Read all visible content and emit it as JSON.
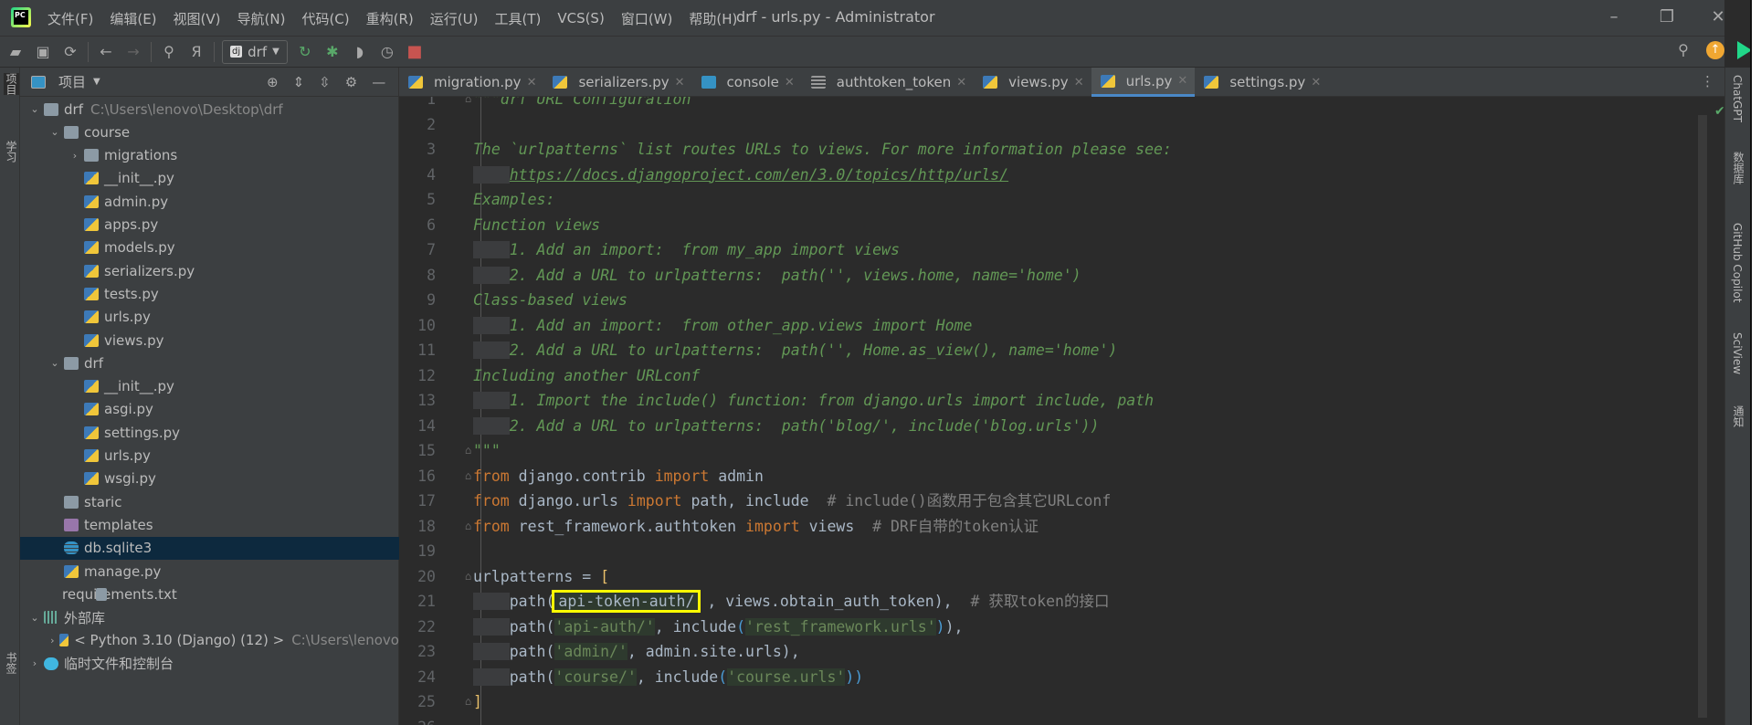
{
  "window": {
    "title": "drf - urls.py - Administrator",
    "minimize": "–",
    "restore": "❐",
    "close": "✕"
  },
  "menu": [
    "文件(F)",
    "编辑(E)",
    "视图(V)",
    "导航(N)",
    "代码(C)",
    "重构(R)",
    "运行(U)",
    "工具(T)",
    "VCS(S)",
    "窗口(W)",
    "帮助(H)"
  ],
  "toolbar": {
    "run_config": "drf",
    "icons": [
      "open-icon",
      "save-icon",
      "sync-icon",
      "back-icon",
      "forward-icon",
      "search-icon",
      "replace-icon"
    ]
  },
  "left_stripe": {
    "project": "项目",
    "learn": "学习",
    "bookmarks": "书签"
  },
  "project": {
    "title": "项目",
    "tree": [
      {
        "level": 0,
        "chev": "⌄",
        "icon": "folder",
        "label": "drf",
        "path": "C:\\Users\\lenovo\\Desktop\\drf"
      },
      {
        "level": 1,
        "chev": "⌄",
        "icon": "folder",
        "label": "course"
      },
      {
        "level": 2,
        "chev": "›",
        "icon": "folder",
        "label": "migrations"
      },
      {
        "level": 2,
        "icon": "py",
        "label": "__init__.py"
      },
      {
        "level": 2,
        "icon": "py",
        "label": "admin.py"
      },
      {
        "level": 2,
        "icon": "py",
        "label": "apps.py"
      },
      {
        "level": 2,
        "icon": "py",
        "label": "models.py"
      },
      {
        "level": 2,
        "icon": "py",
        "label": "serializers.py"
      },
      {
        "level": 2,
        "icon": "py",
        "label": "tests.py"
      },
      {
        "level": 2,
        "icon": "py",
        "label": "urls.py"
      },
      {
        "level": 2,
        "icon": "py",
        "label": "views.py"
      },
      {
        "level": 1,
        "chev": "⌄",
        "icon": "folder",
        "label": "drf"
      },
      {
        "level": 2,
        "icon": "py",
        "label": "__init__.py"
      },
      {
        "level": 2,
        "icon": "py",
        "label": "asgi.py"
      },
      {
        "level": 2,
        "icon": "py",
        "label": "settings.py"
      },
      {
        "level": 2,
        "icon": "py",
        "label": "urls.py"
      },
      {
        "level": 2,
        "icon": "py",
        "label": "wsgi.py"
      },
      {
        "level": 1,
        "icon": "folder",
        "label": "staric"
      },
      {
        "level": 1,
        "icon": "purple",
        "label": "templates"
      },
      {
        "level": 1,
        "icon": "db",
        "label": "db.sqlite3",
        "selected": true
      },
      {
        "level": 1,
        "icon": "py",
        "label": "manage.py"
      },
      {
        "level": 1,
        "icon": "txt",
        "label": "requirements.txt"
      },
      {
        "level": 0,
        "chev": "⌄",
        "icon": "lib",
        "label": "外部库"
      },
      {
        "level": 1,
        "chev": "›",
        "icon": "py",
        "label": "< Python 3.10 (Django) (12) >",
        "path": "C:\\Users\\lenovo"
      },
      {
        "level": 0,
        "chev": "›",
        "icon": "scr",
        "label": "临时文件和控制台"
      }
    ]
  },
  "tabs": [
    {
      "label": "migration.py",
      "icon": "py"
    },
    {
      "label": "serializers.py",
      "icon": "py"
    },
    {
      "label": "console",
      "icon": "console"
    },
    {
      "label": "authtoken_token",
      "icon": "table"
    },
    {
      "label": "views.py",
      "icon": "py"
    },
    {
      "label": "urls.py",
      "icon": "py",
      "active": true
    },
    {
      "label": "settings.py",
      "icon": "py"
    }
  ],
  "inspection": {
    "count": "1"
  },
  "code": [
    [
      [
        "doc",
        "\"\"\"drf URL Configuration"
      ]
    ],
    [],
    [
      [
        "doc",
        "The `urlpatterns` list routes URLs to views. For more information please see:"
      ]
    ],
    [
      [
        "ind",
        "    "
      ],
      [
        "link",
        "https://docs.djangoproject.com/en/3.0/topics/http/urls/"
      ]
    ],
    [
      [
        "doc",
        "Examples:"
      ]
    ],
    [
      [
        "doc",
        "Function views"
      ]
    ],
    [
      [
        "ind",
        "    "
      ],
      [
        "doc",
        "1. Add an import:  from my_app import views"
      ]
    ],
    [
      [
        "ind",
        "    "
      ],
      [
        "doc",
        "2. Add a URL to urlpatterns:  path('', views.home, name='home')"
      ]
    ],
    [
      [
        "doc",
        "Class-based views"
      ]
    ],
    [
      [
        "ind",
        "    "
      ],
      [
        "doc",
        "1. Add an import:  from other_app.views import Home"
      ]
    ],
    [
      [
        "ind",
        "    "
      ],
      [
        "doc",
        "2. Add a URL to urlpatterns:  path('', Home.as_view(), name='home')"
      ]
    ],
    [
      [
        "doc",
        "Including another URLconf"
      ]
    ],
    [
      [
        "ind",
        "    "
      ],
      [
        "doc",
        "1. Import the include() function: from django.urls import include, path"
      ]
    ],
    [
      [
        "ind",
        "    "
      ],
      [
        "doc",
        "2. Add a URL to urlpatterns:  path('blog/', include('blog.urls'))"
      ]
    ],
    [
      [
        "doc",
        "\"\"\""
      ]
    ],
    [
      [
        "kw",
        "from "
      ],
      [
        "def",
        "django.contrib "
      ],
      [
        "kw",
        "import "
      ],
      [
        "def",
        "admin"
      ]
    ],
    [
      [
        "kw",
        "from "
      ],
      [
        "def",
        "django.urls "
      ],
      [
        "kw",
        "import "
      ],
      [
        "def",
        "path, include  "
      ],
      [
        "cmt",
        "# include()函数用于包含其它URLconf"
      ]
    ],
    [
      [
        "kw",
        "from "
      ],
      [
        "def",
        "rest_framework.authtoken "
      ],
      [
        "kw",
        "import "
      ],
      [
        "def",
        "views  "
      ],
      [
        "cmt",
        "# DRF自带的token认证"
      ]
    ],
    [],
    [
      [
        "def",
        "urlpatterns = "
      ],
      [
        "brk",
        "["
      ]
    ],
    [
      [
        "ind",
        "    "
      ],
      [
        "def",
        "path("
      ],
      [
        "box",
        "api-token-auth/"
      ],
      [
        "def",
        " , views.obtain_auth_token),  "
      ],
      [
        "cmt",
        "# 获取token的接口"
      ]
    ],
    [
      [
        "ind",
        "    "
      ],
      [
        "def",
        "path("
      ],
      [
        "str",
        "'api-auth/'"
      ],
      [
        "def",
        ", include"
      ],
      [
        "par",
        "("
      ],
      [
        "str",
        "'rest_framework.urls'"
      ],
      [
        "par",
        ")"
      ],
      [
        "def",
        "),"
      ]
    ],
    [
      [
        "ind",
        "    "
      ],
      [
        "def",
        "path("
      ],
      [
        "str",
        "'admin/'"
      ],
      [
        "def",
        ", admin.site.urls),"
      ]
    ],
    [
      [
        "ind",
        "    "
      ],
      [
        "def",
        "path("
      ],
      [
        "str",
        "'course/'"
      ],
      [
        "def",
        ", include"
      ],
      [
        "par",
        "("
      ],
      [
        "str",
        "'course.urls'"
      ],
      [
        "par",
        "))"
      ]
    ],
    [
      [
        "brk",
        "]"
      ]
    ],
    []
  ],
  "right_stripe": [
    "ChatGPT",
    "数据库",
    "GitHub Copilot",
    "SciView",
    "通知"
  ],
  "colors": {
    "background": "#2b2b2b",
    "panel": "#3c3f41",
    "keyword": "#cc7832",
    "string": "#6a8759",
    "docstring": "#629755",
    "comment": "#808080",
    "highlight_box": "#ffff00",
    "selection": "#0d293e"
  }
}
